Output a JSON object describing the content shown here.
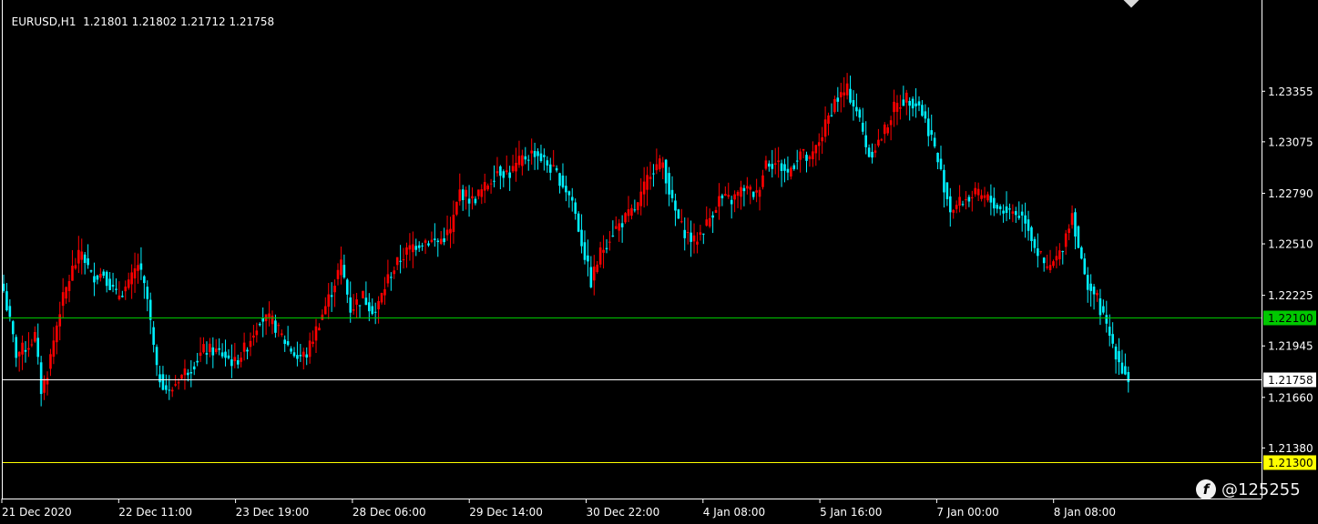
{
  "header": {
    "symbol": "EURUSD,H1",
    "open": "1.21801",
    "high": "1.21802",
    "low": "1.21712",
    "close": "1.21758"
  },
  "watermark": {
    "text": "@125255"
  },
  "colors": {
    "background": "#000000",
    "bull": "#ff0000",
    "bear": "#00f0ff",
    "axis": "#ffffff",
    "level_green": "#00c800",
    "level_white": "#ffffff",
    "level_yellow": "#ffff00"
  },
  "chart_data": {
    "type": "candlestick",
    "ylim": [
      1.211,
      1.2385
    ],
    "y_ticks": [
      "1.23355",
      "1.23075",
      "1.22790",
      "1.22510",
      "1.22225",
      "1.21945",
      "1.21660",
      "1.21380"
    ],
    "x_ticks": [
      "21 Dec 2020",
      "22 Dec 11:00",
      "23 Dec 19:00",
      "28 Dec 06:00",
      "29 Dec 14:00",
      "30 Dec 22:00",
      "4 Jan 08:00",
      "5 Jan 16:00",
      "7 Jan 00:00",
      "8 Jan 08:00"
    ],
    "levels": [
      {
        "price": 1.221,
        "label": "1.22100",
        "color": "#00c800",
        "label_bg": "#00c800",
        "label_color": "#000000"
      },
      {
        "price": 1.21758,
        "label": "1.21758",
        "color": "#ffffff",
        "label_bg": "#ffffff",
        "label_color": "#000000"
      },
      {
        "price": 1.213,
        "label": "1.21300",
        "color": "#ffff00",
        "label_bg": "#ffff00",
        "label_color": "#000000"
      }
    ],
    "close_path": [
      [
        0,
        1.2225
      ],
      [
        4,
        1.219
      ],
      [
        8,
        1.2195
      ],
      [
        10,
        1.22
      ],
      [
        12,
        1.217
      ],
      [
        14,
        1.218
      ],
      [
        18,
        1.2215
      ],
      [
        22,
        1.2237
      ],
      [
        25,
        1.2247
      ],
      [
        28,
        1.2233
      ],
      [
        32,
        1.2235
      ],
      [
        36,
        1.2222
      ],
      [
        40,
        1.2228
      ],
      [
        43,
        1.224
      ],
      [
        46,
        1.222
      ],
      [
        49,
        1.218
      ],
      [
        53,
        1.2168
      ],
      [
        56,
        1.2177
      ],
      [
        60,
        1.2183
      ],
      [
        64,
        1.2192
      ],
      [
        67,
        1.2192
      ],
      [
        70,
        1.219
      ],
      [
        74,
        1.2185
      ],
      [
        78,
        1.2195
      ],
      [
        82,
        1.221
      ],
      [
        86,
        1.2208
      ],
      [
        90,
        1.2197
      ],
      [
        94,
        1.2188
      ],
      [
        97,
        1.219
      ],
      [
        101,
        1.2208
      ],
      [
        105,
        1.2225
      ],
      [
        108,
        1.224
      ],
      [
        111,
        1.2215
      ],
      [
        115,
        1.2222
      ],
      [
        119,
        1.2213
      ],
      [
        123,
        1.2232
      ],
      [
        127,
        1.2243
      ],
      [
        131,
        1.225
      ],
      [
        135,
        1.2253
      ],
      [
        139,
        1.2252
      ],
      [
        143,
        1.2258
      ],
      [
        146,
        1.228
      ],
      [
        150,
        1.2275
      ],
      [
        154,
        1.2282
      ],
      [
        158,
        1.2292
      ],
      [
        162,
        1.229
      ],
      [
        166,
        1.2298
      ],
      [
        170,
        1.2302
      ],
      [
        174,
        1.2295
      ],
      [
        178,
        1.2287
      ],
      [
        182,
        1.2275
      ],
      [
        185,
        1.2252
      ],
      [
        188,
        1.223
      ],
      [
        191,
        1.2246
      ],
      [
        195,
        1.2258
      ],
      [
        199,
        1.2265
      ],
      [
        203,
        1.2272
      ],
      [
        207,
        1.2292
      ],
      [
        211,
        1.2296
      ],
      [
        214,
        1.2273
      ],
      [
        217,
        1.226
      ],
      [
        221,
        1.2252
      ],
      [
        225,
        1.2262
      ],
      [
        229,
        1.2276
      ],
      [
        233,
        1.2275
      ],
      [
        237,
        1.2282
      ],
      [
        241,
        1.2278
      ],
      [
        244,
        1.2297
      ],
      [
        248,
        1.2295
      ],
      [
        251,
        1.229
      ],
      [
        255,
        1.2302
      ],
      [
        258,
        1.2296
      ],
      [
        262,
        1.2312
      ],
      [
        266,
        1.233
      ],
      [
        270,
        1.2336
      ],
      [
        273,
        1.2325
      ],
      [
        277,
        1.23
      ],
      [
        281,
        1.231
      ],
      [
        285,
        1.2326
      ],
      [
        289,
        1.2332
      ],
      [
        293,
        1.2328
      ],
      [
        297,
        1.231
      ],
      [
        300,
        1.229
      ],
      [
        303,
        1.227
      ],
      [
        307,
        1.2275
      ],
      [
        311,
        1.2278
      ],
      [
        315,
        1.2276
      ],
      [
        319,
        1.227
      ],
      [
        323,
        1.2269
      ],
      [
        327,
        1.2265
      ],
      [
        330,
        1.225
      ],
      [
        334,
        1.2236
      ],
      [
        338,
        1.2245
      ],
      [
        342,
        1.2268
      ],
      [
        346,
        1.2232
      ],
      [
        350,
        1.222
      ],
      [
        354,
        1.22
      ],
      [
        358,
        1.2182
      ],
      [
        360,
        1.2176
      ]
    ]
  }
}
